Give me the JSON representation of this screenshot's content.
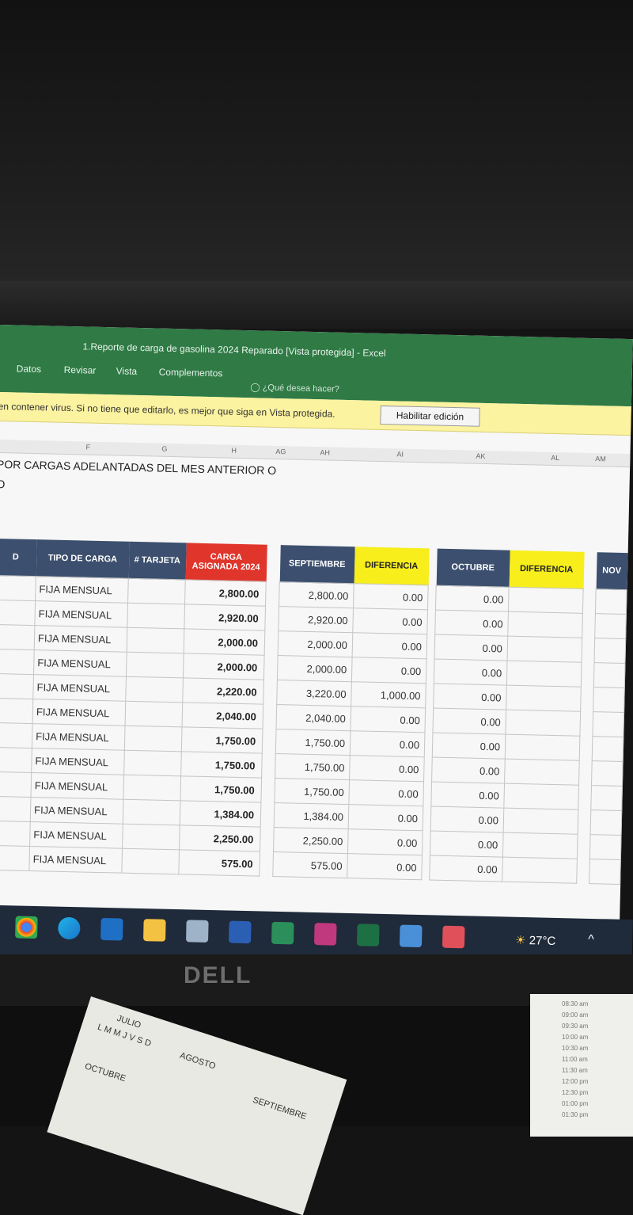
{
  "window": {
    "title": "1.Reporte de carga de gasolina 2024 Reparado  [Vista protegida] - Excel",
    "menu": [
      "Datos",
      "Revisar",
      "Vista",
      "Complementos"
    ],
    "tell_me": "¿Qué desea hacer?"
  },
  "protected_view": {
    "message": "en contener virus. Si no tiene que editarlo, es mejor que siga en Vista protegida.",
    "button": "Habilitar edición"
  },
  "column_letters": [
    "F",
    "G",
    "H",
    "AG",
    "AH",
    "AI",
    "AK",
    "AL",
    "AM"
  ],
  "sheet_heading": {
    "line1": "POR CARGAS ADELANTADAS DEL MES ANTERIOR O",
    "line2": "O"
  },
  "left_table": {
    "headers": {
      "col_d": "D",
      "tipo": "TIPO DE CARGA",
      "tarjeta": "# TARJETA",
      "carga": "CARGA ASIGNADA 2024"
    },
    "rows": [
      {
        "tipo": "FIJA MENSUAL",
        "carga": "2,800.00"
      },
      {
        "tipo": "FIJA MENSUAL",
        "carga": "2,920.00"
      },
      {
        "tipo": "FIJA MENSUAL",
        "carga": "2,000.00"
      },
      {
        "tipo": "FIJA MENSUAL",
        "carga": "2,000.00"
      },
      {
        "tipo": "FIJA MENSUAL",
        "carga": "2,220.00"
      },
      {
        "tipo": "FIJA MENSUAL",
        "carga": "2,040.00"
      },
      {
        "tipo": "FIJA MENSUAL",
        "carga": "1,750.00"
      },
      {
        "tipo": "FIJA MENSUAL",
        "carga": "1,750.00"
      },
      {
        "tipo": "FIJA MENSUAL",
        "carga": "1,750.00"
      },
      {
        "tipo": "FIJA MENSUAL",
        "carga": "1,384.00"
      },
      {
        "tipo": "FIJA MENSUAL",
        "carga": "2,250.00"
      },
      {
        "tipo": "FIJA MENSUAL",
        "carga": "575.00"
      }
    ]
  },
  "sept_table": {
    "headers": {
      "month": "SEPTIEMBRE",
      "diff": "DIFERENCIA"
    },
    "rows": [
      {
        "month": "2,800.00",
        "diff": "0.00"
      },
      {
        "month": "2,920.00",
        "diff": "0.00"
      },
      {
        "month": "2,000.00",
        "diff": "0.00"
      },
      {
        "month": "2,000.00",
        "diff": "0.00"
      },
      {
        "month": "3,220.00",
        "diff": "1,000.00"
      },
      {
        "month": "2,040.00",
        "diff": "0.00"
      },
      {
        "month": "1,750.00",
        "diff": "0.00"
      },
      {
        "month": "1,750.00",
        "diff": "0.00"
      },
      {
        "month": "1,750.00",
        "diff": "0.00"
      },
      {
        "month": "1,384.00",
        "diff": "0.00"
      },
      {
        "month": "2,250.00",
        "diff": "0.00"
      },
      {
        "month": "575.00",
        "diff": "0.00"
      }
    ]
  },
  "oct_table": {
    "headers": {
      "month": "OCTUBRE",
      "diff": "DIFERENCIA"
    },
    "rows": [
      "0.00",
      "0.00",
      "0.00",
      "0.00",
      "0.00",
      "0.00",
      "0.00",
      "0.00",
      "0.00",
      "0.00",
      "0.00",
      "0.00"
    ]
  },
  "nov_table": {
    "header": "NOV"
  },
  "taskbar": {
    "icons": [
      "chrome-icon",
      "edge-icon",
      "outlook-icon",
      "file-explorer-icon",
      "network-icon",
      "word-icon",
      "store-icon",
      "app-icon",
      "excel-icon",
      "calculator-icon",
      "remote-icon"
    ],
    "weather": "27°C",
    "tray": "^"
  },
  "monitor_brand": "DELL",
  "desk": {
    "calendar_months": [
      "JULIO",
      "AGOSTO",
      "SEPTIEMBRE",
      "OCTUBRE"
    ],
    "calendar_days": "L M M J V S D",
    "notebook_times": [
      "08:30 am",
      "09:00 am",
      "09:30 am",
      "10:00 am",
      "10:30 am",
      "11:00 am",
      "11:30 am",
      "12:00 pm",
      "12:30 pm",
      "01:00 pm",
      "01:30 pm"
    ]
  }
}
